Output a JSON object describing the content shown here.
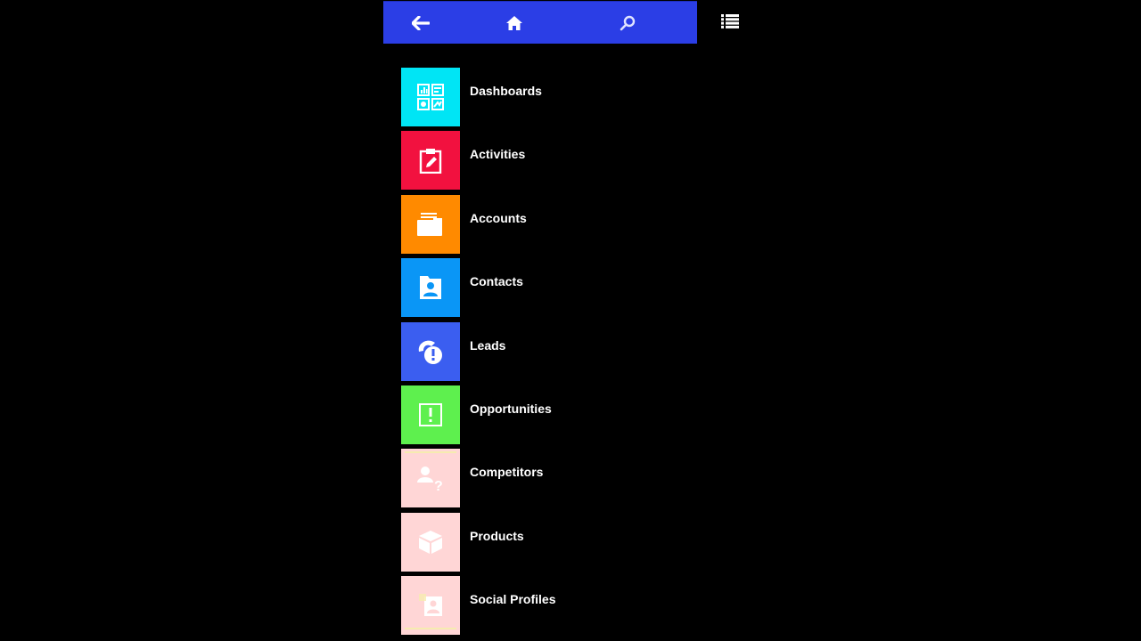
{
  "toolbar": {
    "background": "#2b3ee6",
    "buttons": [
      {
        "name": "back",
        "icon": "arrow-left-icon"
      },
      {
        "name": "home",
        "icon": "home-icon"
      },
      {
        "name": "search",
        "icon": "search-icon"
      }
    ],
    "menu_icon": "list-menu-icon"
  },
  "menu": {
    "items": [
      {
        "label": "Dashboards",
        "color": "#00e5f5",
        "icon": "dashboard-icon"
      },
      {
        "label": "Activities",
        "color": "#f2113f",
        "icon": "clipboard-edit-icon"
      },
      {
        "label": "Accounts",
        "color": "#ff8a00",
        "icon": "folder-icon"
      },
      {
        "label": "Contacts",
        "color": "#0a96f6",
        "icon": "contact-card-icon"
      },
      {
        "label": "Leads",
        "color": "#3b5ef0",
        "icon": "phone-alert-icon"
      },
      {
        "label": "Opportunities",
        "color": "#5ef04e",
        "icon": "opportunity-icon"
      },
      {
        "label": "Competitors",
        "color": "#ffd6d6",
        "icon": "user-question-icon"
      },
      {
        "label": "Products",
        "color": "#ffd6d6",
        "icon": "box-icon"
      },
      {
        "label": "Social Profiles",
        "color": "#ffd6d6",
        "icon": "social-profile-icon"
      }
    ]
  }
}
